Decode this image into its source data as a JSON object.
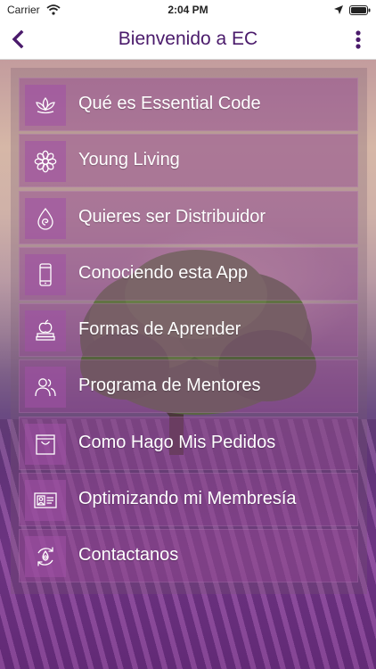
{
  "status_bar": {
    "carrier": "Carrier",
    "time": "2:04 PM"
  },
  "nav": {
    "title": "Bienvenido a EC",
    "back_icon": "chevron-left-icon",
    "more_icon": "vertical-dots-icon"
  },
  "colors": {
    "brand": "#4a1a6b",
    "menu_tile": "#9646a0",
    "icon_stroke": "#ffffff"
  },
  "menu": {
    "items": [
      {
        "label": "Qué es Essential Code",
        "icon": "lotus-icon"
      },
      {
        "label": "Young Living",
        "icon": "flower-icon"
      },
      {
        "label": "Quieres ser Distribuidor",
        "icon": "drop-swirl-icon"
      },
      {
        "label": "Conociendo esta App",
        "icon": "phone-icon"
      },
      {
        "label": "Formas de Aprender",
        "icon": "apple-books-icon"
      },
      {
        "label": "Programa de Mentores",
        "icon": "people-icon"
      },
      {
        "label": "Como Hago Mis Pedidos",
        "icon": "shopping-bag-icon"
      },
      {
        "label": "Optimizando mi Membresía",
        "icon": "id-card-icon"
      },
      {
        "label": "Contactanos",
        "icon": "contact-cycle-icon"
      }
    ]
  }
}
